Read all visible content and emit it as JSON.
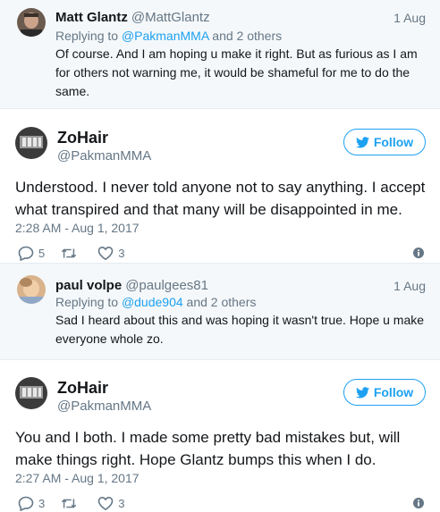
{
  "reply1": {
    "name": "Matt Glantz",
    "handle": "@MattGlantz",
    "date": "1 Aug",
    "replying_prefix": "Replying to ",
    "replying_link": "@PakmanMMA",
    "replying_suffix": " and 2 others",
    "text": "Of course. And I am hoping u make it right. But as furious as I am for others not warning me, it would be shameful for me to do the same."
  },
  "tweet1": {
    "name": "ZoHair",
    "handle": "@PakmanMMA",
    "follow_label": "Follow",
    "text": "Understood. I never told anyone not to say anything. I accept what transpired and that many will be disappointed in me.",
    "timestamp": "2:28 AM - Aug 1, 2017",
    "reply_count": "5",
    "retweet_count": "",
    "like_count": "3"
  },
  "reply2": {
    "name": "paul volpe",
    "handle": "@paulgees81",
    "date": "1 Aug",
    "replying_prefix": "Replying to ",
    "replying_link": "@dude904",
    "replying_suffix": " and 2 others",
    "text": "Sad I heard about this and was hoping it wasn't true. Hope u make everyone whole zo."
  },
  "tweet2": {
    "name": "ZoHair",
    "handle": "@PakmanMMA",
    "follow_label": "Follow",
    "text": "You and I both. I made some pretty bad mistakes but, will make things right. Hope Glantz bumps this when I do.",
    "timestamp": "2:27 AM - Aug 1, 2017",
    "reply_count": "3",
    "retweet_count": "",
    "like_count": "3"
  },
  "colors": {
    "accent": "#1da1f2",
    "secondary_text": "#657786",
    "reply_background": "#f5f8fa"
  }
}
